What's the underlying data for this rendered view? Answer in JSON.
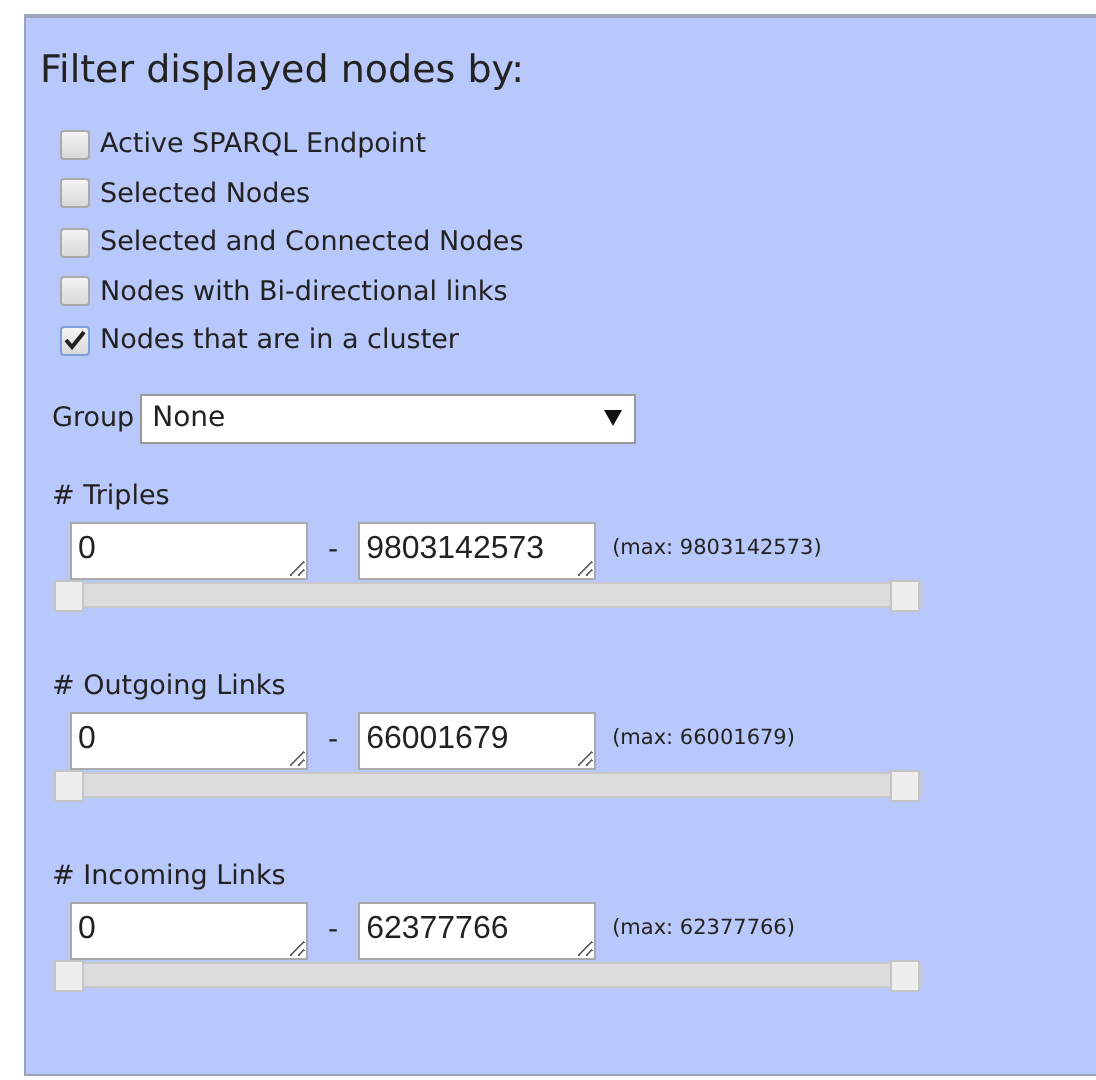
{
  "title": "Filter displayed nodes by:",
  "filters": [
    {
      "label": "Active SPARQL Endpoint",
      "checked": false
    },
    {
      "label": "Selected Nodes",
      "checked": false
    },
    {
      "label": "Selected and Connected Nodes",
      "checked": false
    },
    {
      "label": "Nodes with Bi-directional links",
      "checked": false
    },
    {
      "label": "Nodes that are in a cluster",
      "checked": true
    }
  ],
  "group": {
    "label": "Group",
    "value": "None"
  },
  "ranges": [
    {
      "label": "# Triples",
      "min": "0",
      "separator": "-",
      "max": "9803142573",
      "limit": "(max: 9803142573)",
      "handles": [
        {
          "level": 0
        },
        {
          "level": 1
        }
      ]
    },
    {
      "label": "# Outgoing Links",
      "min": "0",
      "separator": "-",
      "max": "66001679",
      "limit": "(max: 66001679)",
      "handles": [
        {
          "level": 0
        },
        {
          "level": 1
        }
      ]
    },
    {
      "label": "# Incoming Links",
      "min": "0",
      "separator": "-",
      "max": "62377766",
      "limit": "(max: 62377766)",
      "handles": [
        {
          "level": 0
        },
        {
          "level": 1
        }
      ]
    }
  ]
}
